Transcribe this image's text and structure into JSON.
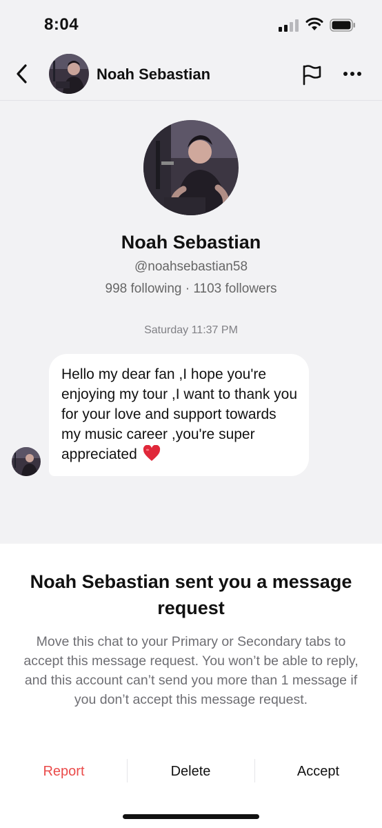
{
  "status_bar": {
    "time": "8:04"
  },
  "header": {
    "name": "Noah Sebastian"
  },
  "profile": {
    "name": "Noah Sebastian",
    "handle": "@noahsebastian58",
    "stats": "998 following · 1103 followers"
  },
  "chat": {
    "timestamp": "Saturday 11:37 PM",
    "message": "Hello my dear fan ,I hope you're enjoying my tour ,I want to thank you for your love and support towards my music career ,you're super appreciated"
  },
  "request": {
    "title": "Noah Sebastian sent you a message request",
    "body": "Move this chat to your Primary or Secondary tabs to accept this message request. You won’t be able to reply, and this account can’t send you more than 1 message if you don’t accept this message request.",
    "report_label": "Report",
    "delete_label": "Delete",
    "accept_label": "Accept"
  },
  "colors": {
    "report": "#ea4b4a",
    "background": "#f2f2f4",
    "bubble": "#ffffff"
  },
  "icons": [
    "back-icon",
    "flag-icon",
    "more-icon",
    "signal-icon",
    "wifi-icon",
    "battery-icon",
    "heart-emoji-icon"
  ]
}
